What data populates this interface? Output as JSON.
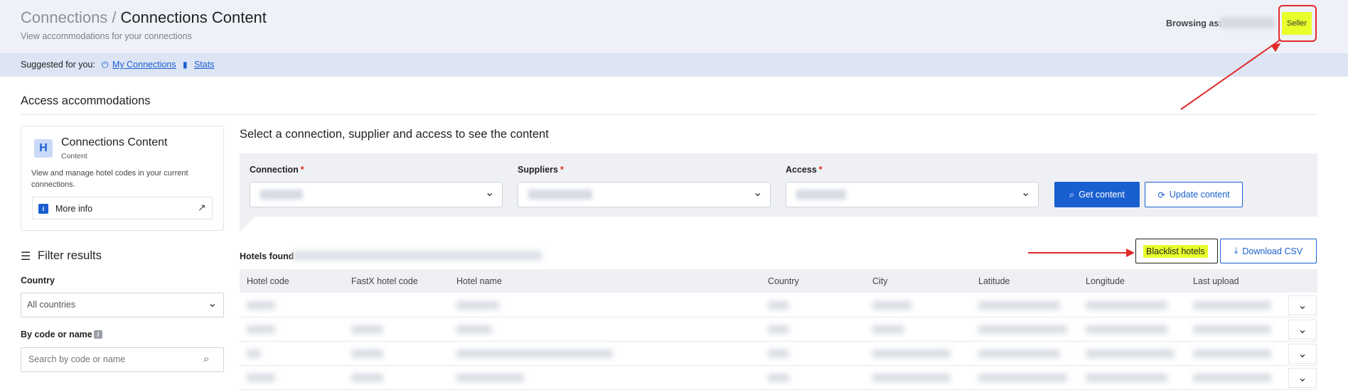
{
  "header": {
    "parent": "Connections",
    "separator": "/",
    "title": "Connections Content",
    "subtitle": "View accommodations for your connections",
    "browsing_label": "Browsing as:",
    "role": "Seller"
  },
  "suggested": {
    "label": "Suggested for you:",
    "links": [
      "My Connections",
      "Stats"
    ]
  },
  "section_title": "Access accommodations",
  "card": {
    "logo": "H",
    "title": "Connections Content",
    "subtitle": "Content",
    "description": "View and manage hotel codes in your current connections.",
    "more_info": "More info"
  },
  "filters": {
    "title": "Filter results",
    "country_label": "Country",
    "country_value": "All countries",
    "code_label": "By code or name",
    "search_placeholder": "Search by code or name"
  },
  "main": {
    "title": "Select a connection, supplier and access to see the content",
    "connection_label": "Connection",
    "suppliers_label": "Suppliers",
    "access_label": "Access",
    "required_mark": "*",
    "get_content": "Get content",
    "update_content": "Update content"
  },
  "results": {
    "hotels_found": "Hotels found",
    "blacklist": "Blacklist hotels",
    "download": "Download CSV",
    "columns": [
      "Hotel code",
      "FastX hotel code",
      "Hotel name",
      "Country",
      "City",
      "Latitude",
      "Longitude",
      "Last upload"
    ]
  },
  "icons": {
    "plug": "plug-icon",
    "stats": "bar-chart-icon",
    "filter": "filter-icon",
    "search": "search-icon",
    "chevron": "chevron-down-icon"
  },
  "colors": {
    "accent": "#1a5fd0",
    "highlight": "#e8ff2a",
    "annotation": "#e12b2b"
  }
}
